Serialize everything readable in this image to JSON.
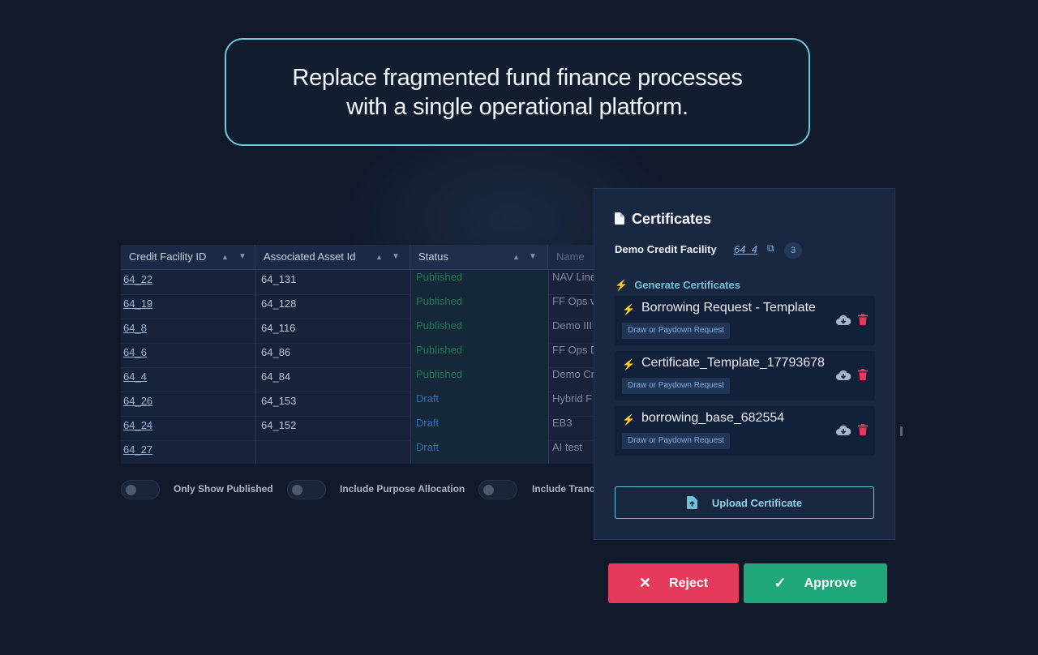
{
  "headline": {
    "line1": "Replace fragmented fund finance processes",
    "line2": "with a single operational platform."
  },
  "table": {
    "headers": [
      "Credit Facility ID",
      "Associated Asset Id",
      "Status",
      "Name"
    ],
    "rows": [
      {
        "id": "64_22",
        "asset": "64_131",
        "status": "Published",
        "name": "NAV Line"
      },
      {
        "id": "64_19",
        "asset": "64_128",
        "status": "Published",
        "name": "FF Ops v"
      },
      {
        "id": "64_8",
        "asset": "64_116",
        "status": "Published",
        "name": "Demo III"
      },
      {
        "id": "64_6",
        "asset": "64_86",
        "status": "Published",
        "name": "FF Ops D"
      },
      {
        "id": "64_4",
        "asset": "64_84",
        "status": "Published",
        "name": "Demo Cr"
      },
      {
        "id": "64_26",
        "asset": "64_153",
        "status": "Draft",
        "name": "Hybrid F"
      },
      {
        "id": "64_24",
        "asset": "64_152",
        "status": "Draft",
        "name": "EB3"
      },
      {
        "id": "64_27",
        "asset": "",
        "status": "Draft",
        "name": "AI test"
      }
    ],
    "toggles": [
      "Only Show Published",
      "Include Purpose Allocation",
      "Include Tranc"
    ]
  },
  "panel": {
    "title": "Certificates",
    "facility_name": "Demo Credit Facility",
    "facility_link": "64_4",
    "count": "3",
    "generate_label": "Generate Certificates",
    "certificates": [
      {
        "name": "Borrowing Request - Template",
        "tag": "Draw or Paydown Request"
      },
      {
        "name": "Certificate_Template_17793678",
        "tag": "Draw or Paydown Request"
      },
      {
        "name": "borrowing_base_682554",
        "tag": "Draw or Paydown Request"
      }
    ],
    "upload_label": "Upload Certificate"
  },
  "actions": {
    "reject_label": "Reject",
    "approve_label": "Approve"
  },
  "colors": {
    "accent": "#6cc9dc",
    "reject": "#e63a5a",
    "approve": "#1fa67a",
    "published": "#1f7a55",
    "draft": "#2f6fb3"
  }
}
